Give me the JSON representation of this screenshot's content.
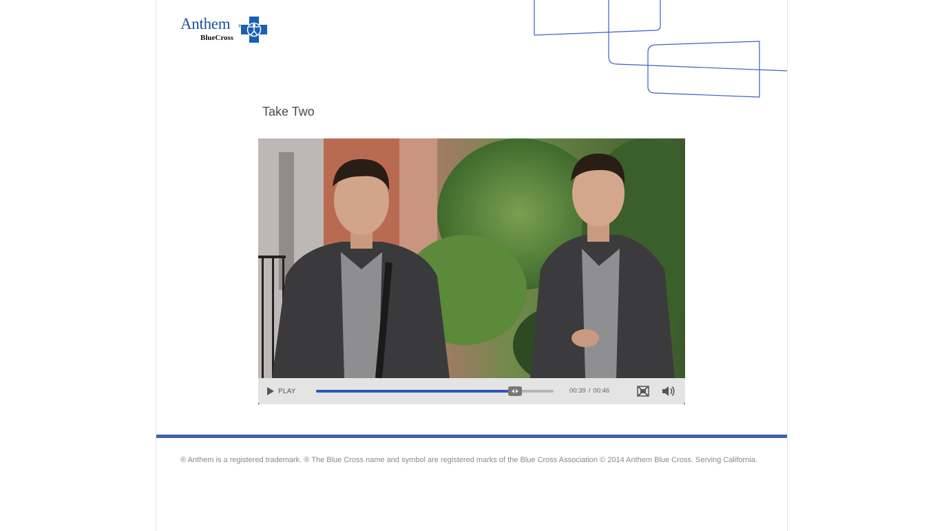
{
  "brand": {
    "logo_word": "Anthem",
    "logo_sub": "BlueCross",
    "logo_reg": "®",
    "primary_color": "#1a4f9c",
    "accent_color": "#2b58b8",
    "footer_bar_color": "#3e63ad"
  },
  "page": {
    "title": "Take Two"
  },
  "video": {
    "play_label": "PLAY",
    "current_time": "00:39",
    "separator": "/",
    "duration": "00:46",
    "progress_fraction": 0.839,
    "icons": {
      "play": "play-icon",
      "fullscreen": "fullscreen-icon",
      "volume": "volume-icon",
      "scrubber": "scrubber-handle-icon"
    }
  },
  "footer": {
    "text": "® Anthem is a registered trademark. ® The Blue Cross name and symbol are registered marks of the Blue Cross Association © 2014 Anthem Blue Cross. Serving California."
  }
}
